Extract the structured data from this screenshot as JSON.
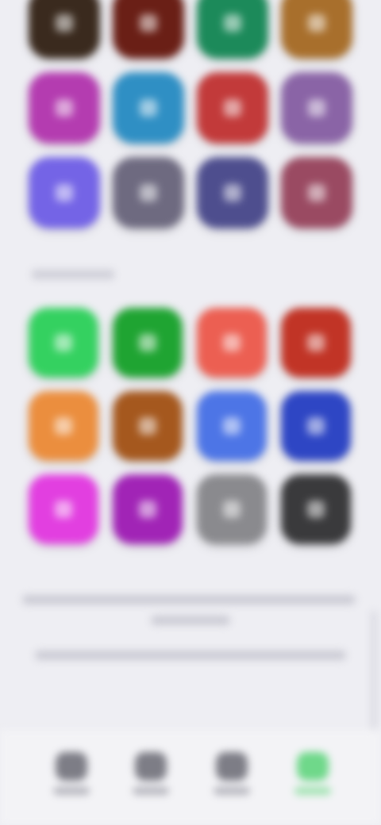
{
  "top_grid": {
    "tiles": [
      {
        "icon": "app-icon",
        "color": "#3a2a1e"
      },
      {
        "icon": "app-icon",
        "color": "#6a1f16"
      },
      {
        "icon": "app-icon",
        "color": "#1c8a5a"
      },
      {
        "icon": "app-icon",
        "color": "#a86f2c"
      },
      {
        "icon": "app-icon",
        "color": "#b43cb0"
      },
      {
        "icon": "app-icon",
        "color": "#2f8fc4"
      },
      {
        "icon": "app-icon",
        "color": "#c23a3a"
      },
      {
        "icon": "app-icon",
        "color": "#8a64a6"
      },
      {
        "icon": "app-icon",
        "color": "#7464e6"
      },
      {
        "icon": "app-icon",
        "color": "#6e6a80"
      },
      {
        "icon": "app-icon",
        "color": "#4e4e8e"
      },
      {
        "icon": "app-icon",
        "color": "#9a4a62"
      }
    ]
  },
  "bottom_grid": {
    "tiles": [
      {
        "icon": "app-icon",
        "color": "#34d160"
      },
      {
        "icon": "app-icon",
        "color": "#1fa432"
      },
      {
        "icon": "app-icon",
        "color": "#ec5f52"
      },
      {
        "icon": "app-icon",
        "color": "#c13426"
      },
      {
        "icon": "app-icon",
        "color": "#eb8e3e"
      },
      {
        "icon": "app-icon",
        "color": "#a5581e"
      },
      {
        "icon": "app-icon",
        "color": "#4d75e6"
      },
      {
        "icon": "app-icon",
        "color": "#2e46c4"
      },
      {
        "icon": "app-icon",
        "color": "#e23fe0"
      },
      {
        "icon": "app-icon",
        "color": "#a124b6"
      },
      {
        "icon": "app-icon",
        "color": "#8a8a8e"
      },
      {
        "icon": "app-icon",
        "color": "#3a3a3c"
      }
    ]
  },
  "tabbar": {
    "tabs": [
      {
        "icon": "tab-icon",
        "active": false
      },
      {
        "icon": "tab-icon",
        "active": false
      },
      {
        "icon": "tab-icon",
        "active": false
      },
      {
        "icon": "tab-icon",
        "active": true
      }
    ],
    "active_color": "#6fd88a"
  }
}
